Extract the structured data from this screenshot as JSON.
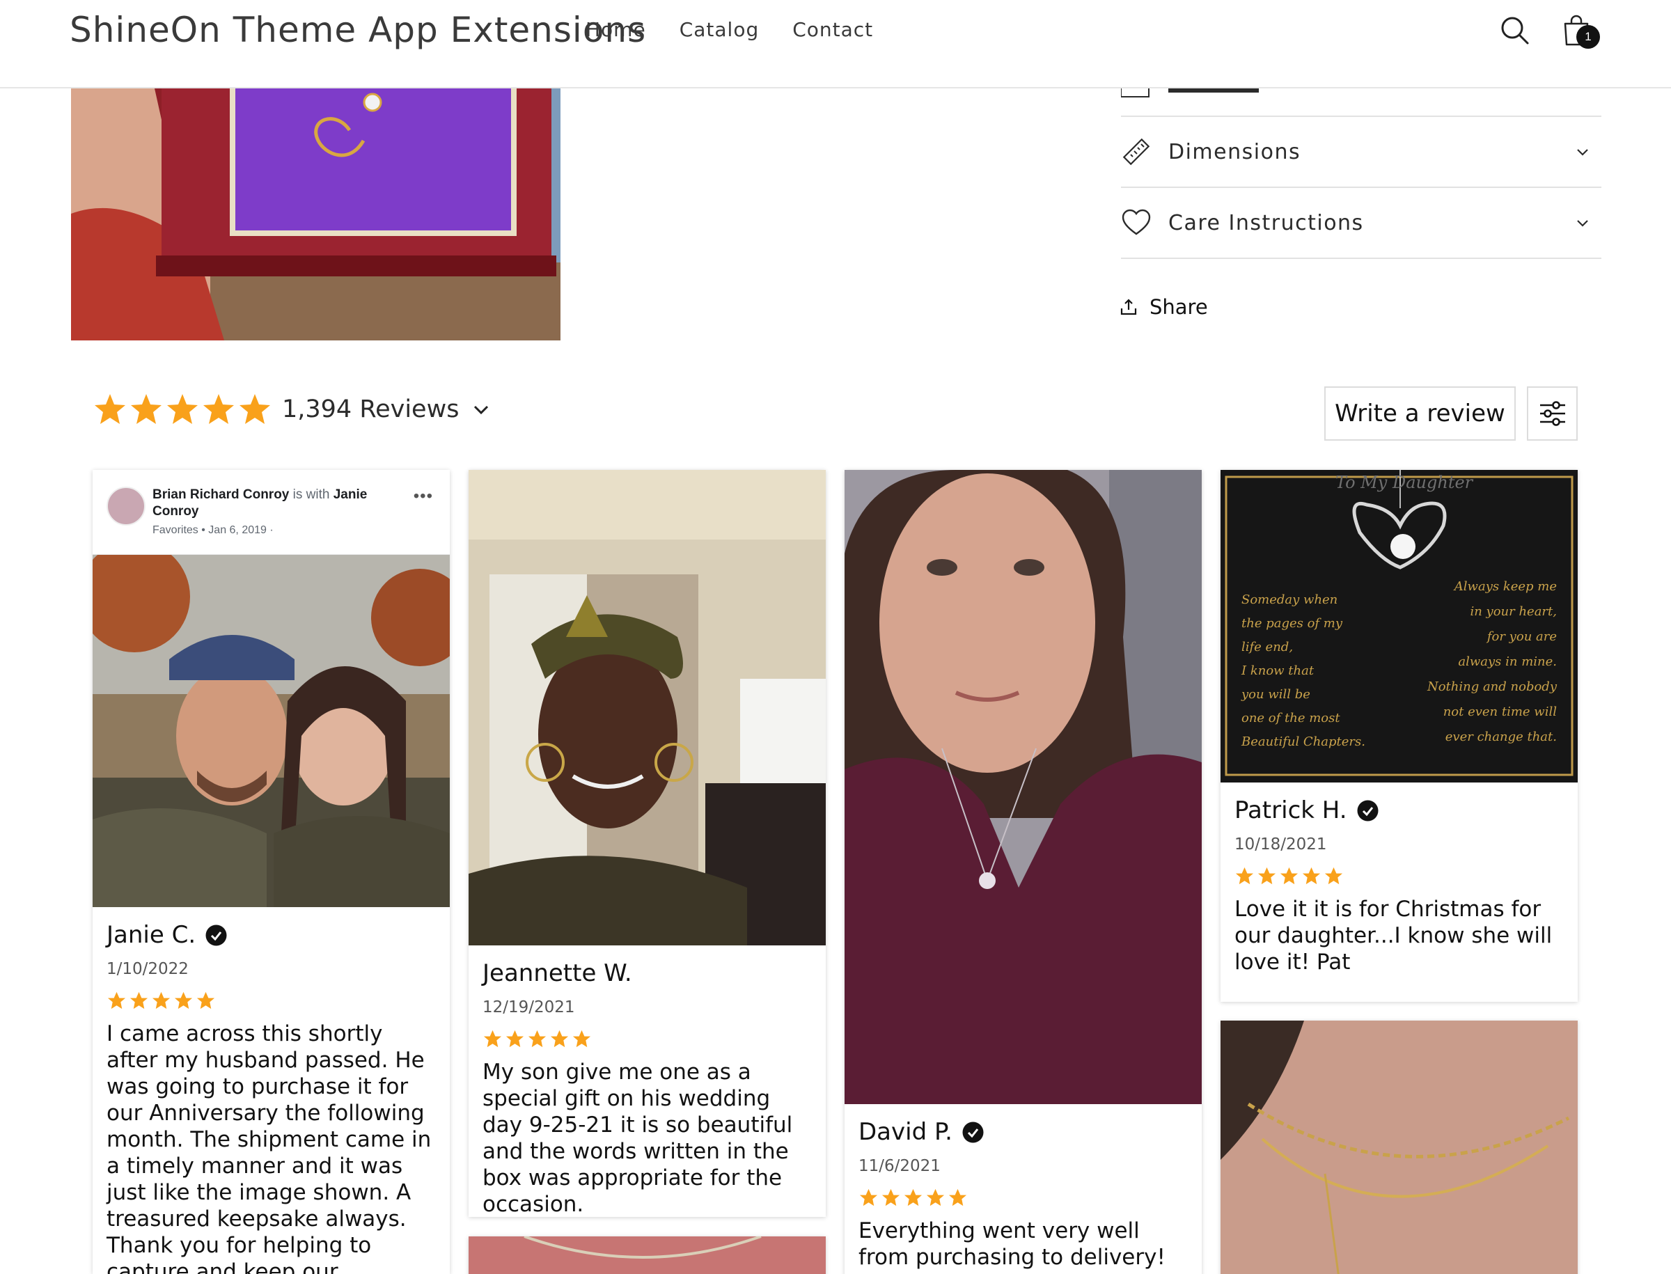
{
  "header": {
    "site_title": "ShineOn Theme App Extensions",
    "nav": [
      "Home",
      "Catalog",
      "Contact"
    ],
    "cart_count": "1"
  },
  "product": {
    "accordions": [
      {
        "label": "Dimensions",
        "icon": "ruler-icon"
      },
      {
        "label": "Care Instructions",
        "icon": "heart-icon"
      }
    ],
    "share_label": "Share"
  },
  "reviews": {
    "rating": 5,
    "count_label": "1,394 Reviews",
    "write_label": "Write a review",
    "star_color": "#f9a11b",
    "items": [
      {
        "name": "Janie C.",
        "date": "1/10/2022",
        "stars": 5,
        "text": "I came across this shortly after my husband passed. He was going to purchase it for our Anniversary the following month. The shipment came in a timely manner and it was just like the image shown. A treasured keepsake always. Thank you for helping to capture and keep our",
        "photo_header": {
          "author": "Brian Richard Conroy",
          "with_text": "is with",
          "with_name": "Janie",
          "with_name2": "Conroy",
          "meta": "Favorites • Jan 6, 2019 ·"
        }
      },
      {
        "name": "Jeannette W.",
        "date": "12/19/2021",
        "stars": 5,
        "text": "My son give me one as a special gift on his wedding day 9-25-21 it is so beautiful and the words written in the box was appropriate for the occasion."
      },
      {
        "name": "David P.",
        "date": "11/6/2021",
        "stars": 5,
        "text": "Everything went very well from purchasing to delivery! When I"
      },
      {
        "name": "Patrick H.",
        "date": "10/18/2021",
        "stars": 5,
        "text": "Love it it is for Christmas for our daughter...I know she will love it! Pat",
        "photo_card": {
          "title": "To My Daughter",
          "left_text": [
            "Someday when",
            "the pages of my",
            "life end,",
            "I know that",
            "you will be",
            "one of the most",
            "Beautiful Chapters."
          ],
          "right_text": [
            "Always keep me",
            "in your heart,",
            "for you are",
            "always in mine.",
            "Nothing and nobody",
            "not even time will",
            "ever change that."
          ]
        }
      }
    ]
  }
}
